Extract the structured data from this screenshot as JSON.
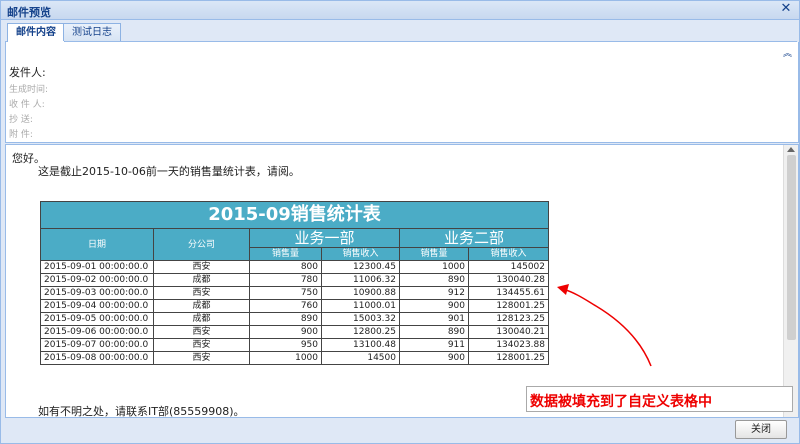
{
  "window": {
    "title": "邮件预览"
  },
  "tabs": [
    {
      "label": "邮件内容"
    },
    {
      "label": "测试日志"
    }
  ],
  "header": {
    "sender_label": "发件人:",
    "generated_label": "生成时间:",
    "recipient_label": "收 件 人:",
    "cc_label": "抄    送:",
    "attachment_label": "附    件:"
  },
  "body": {
    "greeting": "您好。",
    "intro": "这是截止2015-10-06前一天的销售量统计表，请阅。",
    "footer": "如有不明之处，请联系IT部(85559908)。"
  },
  "table": {
    "title": "2015-09销售统计表",
    "col_date": "日期",
    "col_branch": "分公司",
    "dept1": "业务一部",
    "dept2": "业务二部",
    "sub_qty": "销售量",
    "sub_rev": "销售收入",
    "rows": [
      {
        "date": "2015-09-01 00:00:00.0",
        "branch": "西安",
        "q1": "800",
        "r1": "12300.45",
        "q2": "1000",
        "r2": "145002"
      },
      {
        "date": "2015-09-02 00:00:00.0",
        "branch": "成都",
        "q1": "780",
        "r1": "11006.32",
        "q2": "890",
        "r2": "130040.28"
      },
      {
        "date": "2015-09-03 00:00:00.0",
        "branch": "西安",
        "q1": "750",
        "r1": "10900.88",
        "q2": "912",
        "r2": "134455.61"
      },
      {
        "date": "2015-09-04 00:00:00.0",
        "branch": "成都",
        "q1": "760",
        "r1": "11000.01",
        "q2": "900",
        "r2": "128001.25"
      },
      {
        "date": "2015-09-05 00:00:00.0",
        "branch": "成都",
        "q1": "890",
        "r1": "15003.32",
        "q2": "901",
        "r2": "128123.25"
      },
      {
        "date": "2015-09-06 00:00:00.0",
        "branch": "西安",
        "q1": "900",
        "r1": "12800.25",
        "q2": "890",
        "r2": "130040.21"
      },
      {
        "date": "2015-09-07 00:00:00.0",
        "branch": "西安",
        "q1": "950",
        "r1": "13100.48",
        "q2": "911",
        "r2": "134023.88"
      },
      {
        "date": "2015-09-08 00:00:00.0",
        "branch": "西安",
        "q1": "1000",
        "r1": "14500",
        "q2": "900",
        "r2": "128001.25"
      }
    ]
  },
  "annotation": {
    "text": "数据被填充到了自定义表格中",
    "color": "#e00000"
  },
  "buttons": {
    "close": "关闭"
  },
  "icons": {
    "window_close": "close-icon",
    "collapse": "double-chevron-up-icon",
    "arrow": "red-curved-arrow"
  }
}
